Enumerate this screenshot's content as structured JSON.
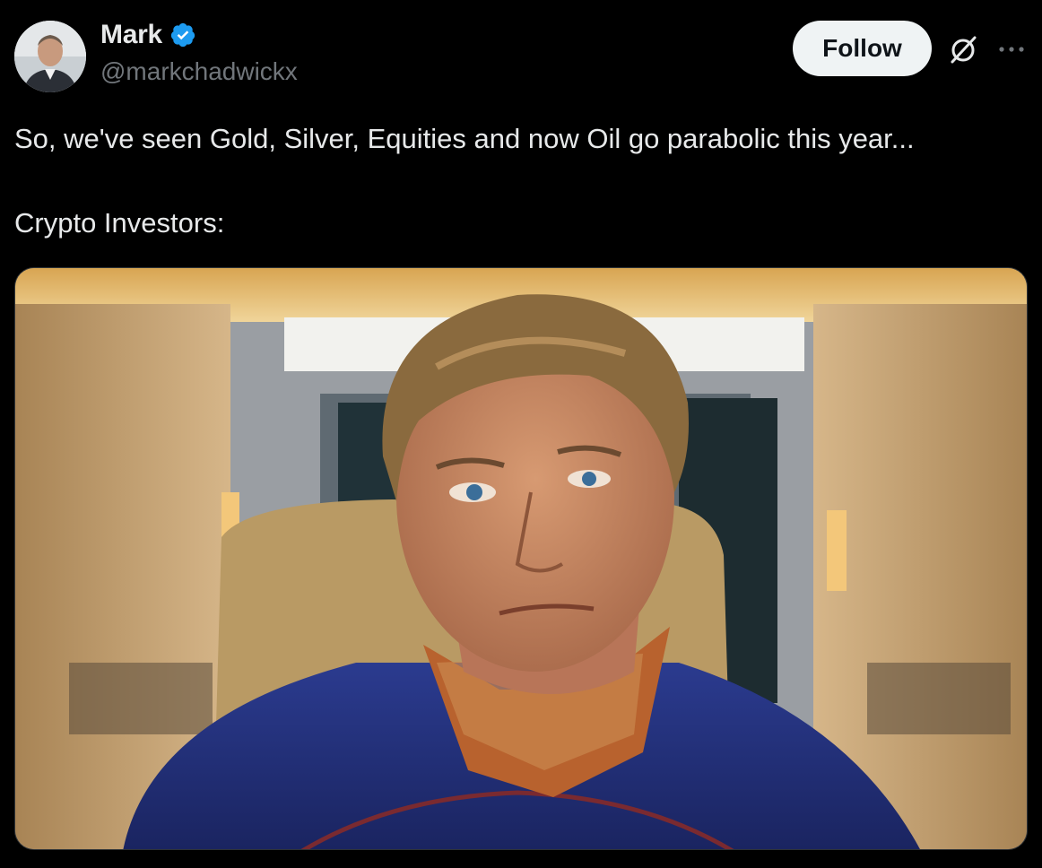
{
  "author": {
    "display_name": "Mark",
    "handle": "@markchadwickx",
    "verified": true,
    "verified_color": "#1d9bf0"
  },
  "actions": {
    "follow_label": "Follow",
    "grok_icon": "grok-icon",
    "more_icon": "more-options-icon"
  },
  "tweet": {
    "text_line_1": "So, we've seen Gold, Silver, Equities and now Oil go parabolic this year...",
    "text_line_2": "Crypto Investors:"
  },
  "colors": {
    "background": "#000000",
    "text_primary": "#e7e9ea",
    "text_secondary": "#71767b",
    "follow_bg": "#eff3f4"
  }
}
